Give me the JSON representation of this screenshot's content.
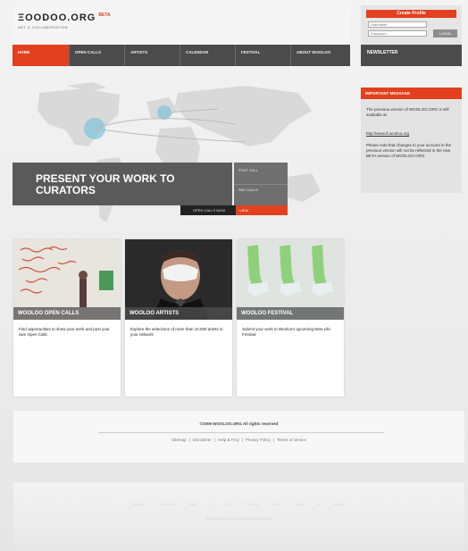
{
  "header": {
    "logo": "ΞOODOO.ORG",
    "beta": "BETA",
    "tagline": "ART & COLLABORATION"
  },
  "login": {
    "title": "Create Profile",
    "username_placeholder": "Username",
    "password_placeholder": "Password",
    "button": "LOGIN"
  },
  "nav": {
    "items": [
      {
        "label": "HOME"
      },
      {
        "label": "OPEN CALLS"
      },
      {
        "label": "ARTISTS"
      },
      {
        "label": "CALENDAR"
      },
      {
        "label": "FESTIVAL"
      },
      {
        "label": "ABOUT WOOLOO"
      }
    ],
    "newsletter": "NEWSLETTER"
  },
  "hero": {
    "headline": "PRESENT YOUR WORK TO CURATORS",
    "side_item_1": "POST CALL",
    "side_item_2": "SEE CALLS",
    "bar_label": "OPEN CALLS NOW",
    "bar_button": "VIEW"
  },
  "important": {
    "title": "IMPORTANT MESSAGE",
    "paragraph1": "The previous version of WOOLOO.ORG is still available at",
    "link": "http://www.ß.wooloo.org",
    "paragraph2": "Please note that changes to your account in the previous version will not be reflected in the new BETA version of WOOLOO.ORG."
  },
  "cards": [
    {
      "caption": "WOOLOO OPEN CALLS",
      "text": "Find opportunities to show your work and post your own Open Calls"
    },
    {
      "caption": "WOOLOO ARTISTS",
      "text": "Explore the selections of more than 10,000 artists in your network"
    },
    {
      "caption": "WOOLOO FESTIVAL",
      "text": "Submit your work to Wooloo's upcoming New Life Festival"
    }
  ],
  "footer": {
    "copyright": "©2009 WOOLOO.ORG All rights reserved",
    "links": [
      "Sitemap",
      "Disclaimer",
      "Help & FAQ",
      "Privacy Policy",
      "Terms of service"
    ]
  },
  "colors": {
    "accent": "#e2401e",
    "nav": "#4b4b4b"
  }
}
